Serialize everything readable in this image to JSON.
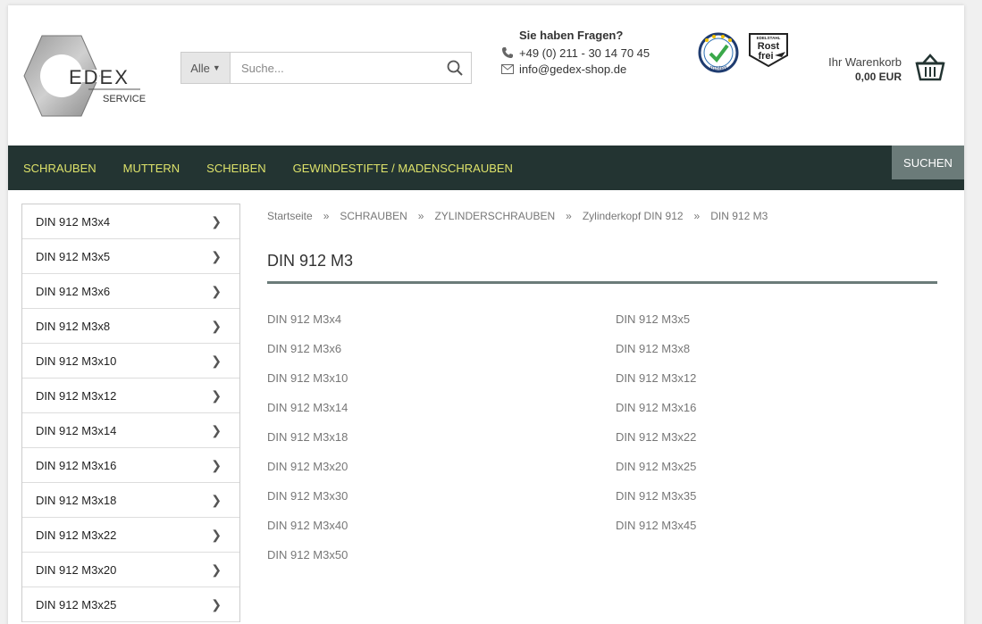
{
  "logo": {
    "main": "EDEX",
    "sub": "SERVICE"
  },
  "search": {
    "category": "Alle",
    "placeholder": "Suche..."
  },
  "contact": {
    "title": "Sie haben Fragen?",
    "phone": "+49 (0) 211 - 30 14 70 45",
    "email": "info@gedex-shop.de"
  },
  "badges": {
    "rost_line1": "Rost",
    "rost_line2": "frei",
    "rost_top": "EDELSTAHL",
    "trust": "trusted"
  },
  "cart": {
    "label": "Ihr Warenkorb",
    "total": "0,00 EUR"
  },
  "nav": {
    "items": [
      {
        "label": "SCHRAUBEN"
      },
      {
        "label": "MUTTERN"
      },
      {
        "label": "SCHEIBEN"
      },
      {
        "label": "GEWINDESTIFTE / MADENSCHRAUBEN"
      }
    ],
    "search_label": "SUCHEN"
  },
  "sidebar": {
    "items": [
      {
        "label": "DIN 912 M3x4"
      },
      {
        "label": "DIN 912 M3x5"
      },
      {
        "label": "DIN 912 M3x6"
      },
      {
        "label": "DIN 912 M3x8"
      },
      {
        "label": "DIN 912 M3x10"
      },
      {
        "label": "DIN 912 M3x12"
      },
      {
        "label": "DIN 912 M3x14"
      },
      {
        "label": "DIN 912 M3x16"
      },
      {
        "label": "DIN 912 M3x18"
      },
      {
        "label": "DIN 912 M3x22"
      },
      {
        "label": "DIN 912 M3x20"
      },
      {
        "label": "DIN 912 M3x25"
      }
    ]
  },
  "breadcrumb": {
    "separator": "»",
    "items": [
      {
        "label": "Startseite"
      },
      {
        "label": "SCHRAUBEN"
      },
      {
        "label": "ZYLINDERSCHRAUBEN"
      },
      {
        "label": "Zylinderkopf DIN 912"
      },
      {
        "label": "DIN 912 M3"
      }
    ]
  },
  "main": {
    "title": "DIN 912 M3",
    "subcategories": [
      {
        "label": "DIN 912 M3x4"
      },
      {
        "label": "DIN 912 M3x5"
      },
      {
        "label": "DIN 912 M3x6"
      },
      {
        "label": "DIN 912 M3x8"
      },
      {
        "label": "DIN 912 M3x10"
      },
      {
        "label": "DIN 912 M3x12"
      },
      {
        "label": "DIN 912 M3x14"
      },
      {
        "label": "DIN 912 M3x16"
      },
      {
        "label": "DIN 912 M3x18"
      },
      {
        "label": "DIN 912 M3x22"
      },
      {
        "label": "DIN 912 M3x20"
      },
      {
        "label": "DIN 912 M3x25"
      },
      {
        "label": "DIN 912 M3x30"
      },
      {
        "label": "DIN 912 M3x35"
      },
      {
        "label": "DIN 912 M3x40"
      },
      {
        "label": "DIN 912 M3x45"
      },
      {
        "label": "DIN 912 M3x50"
      }
    ]
  },
  "colors": {
    "nav_bg": "#233432",
    "nav_text": "#dde26a",
    "accent": "#6b7b79"
  }
}
